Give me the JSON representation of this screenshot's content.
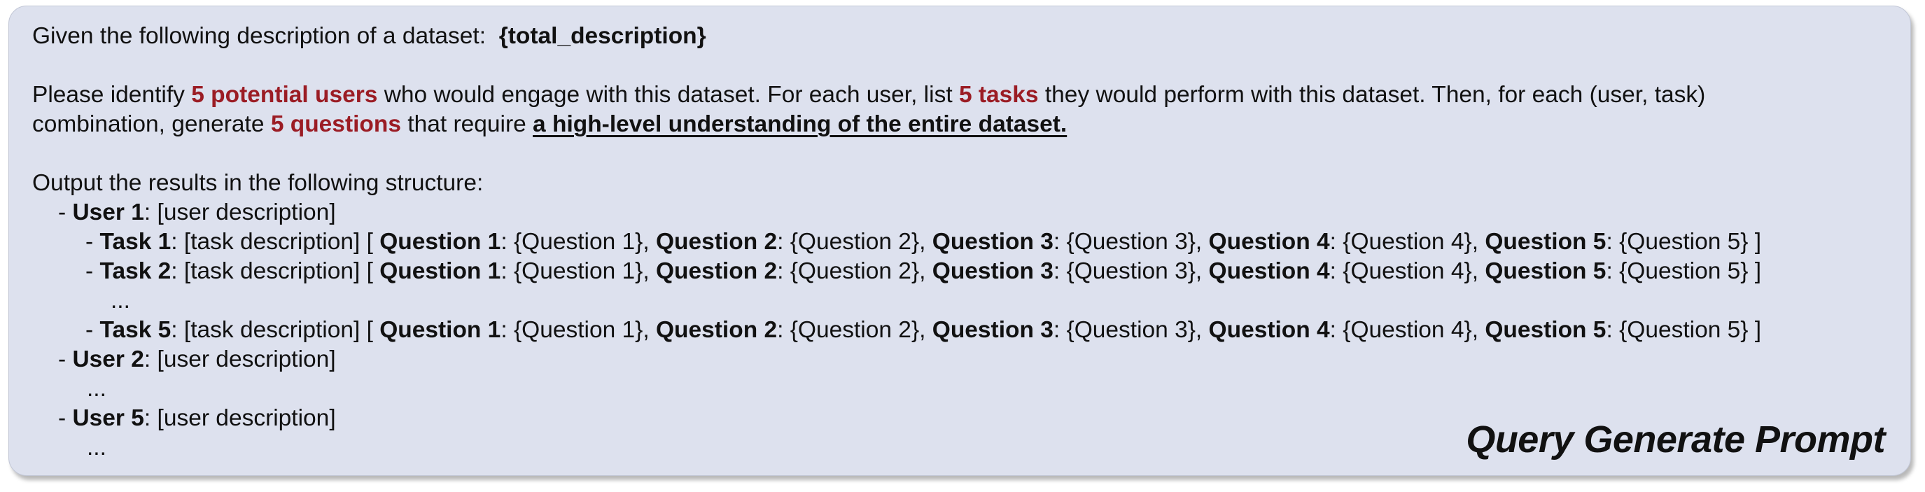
{
  "intro": {
    "prefix": "Given the following description of a dataset:",
    "placeholder": "{total_description}"
  },
  "instruction": {
    "p1": "Please identify ",
    "users_count": "5 potential users",
    "p2": " who would engage with this dataset. For each user, list ",
    "tasks_count": "5 tasks",
    "p3": " they would perform with this dataset. Then, for each (user, task)",
    "p4": "combination, generate ",
    "questions_count": "5 questions",
    "p5": " that require ",
    "emphasis": "a high-level understanding of the entire dataset."
  },
  "structure_intro": "Output the results in the following structure:",
  "tokens": {
    "dash": "- ",
    "colon": ":",
    "user_desc": " [user description]",
    "task_desc": " [task description] [ ",
    "sep": ", ",
    "close": " ]",
    "ellipsis": "..."
  },
  "users": {
    "u1": "User 1",
    "u2": "User 2",
    "u5": "User 5"
  },
  "tasks": {
    "t1": "Task 1",
    "t2": "Task 2",
    "t5": "Task 5"
  },
  "questions": {
    "q1_label": "Question 1",
    "q1_value": " {Question 1}",
    "q2_label": "Question 2",
    "q2_value": " {Question 2}",
    "q3_label": "Question 3",
    "q3_value": " {Question 3}",
    "q4_label": "Question 4",
    "q4_value": " {Question 4}",
    "q5_label": "Question 5",
    "q5_value": " {Question 5}"
  },
  "title": "Query Generate Prompt",
  "colors": {
    "card_background": "#dde1ee",
    "highlight_red": "#9b1c24",
    "text": "#111111"
  }
}
